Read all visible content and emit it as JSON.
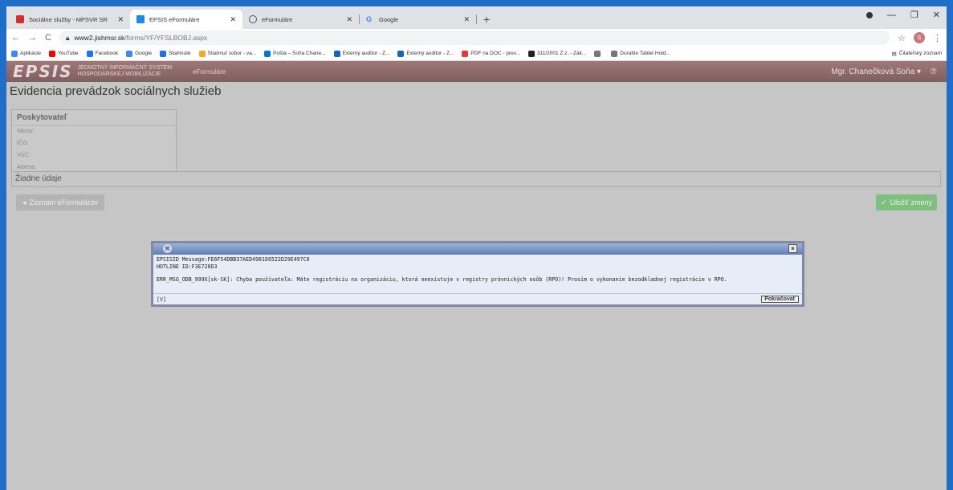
{
  "browser": {
    "tabs": [
      {
        "title": "Sociálne služby - MPSVR SR",
        "active": false,
        "favicon_color": "#d32f2f"
      },
      {
        "title": "EPSIS eFormuláre",
        "active": true,
        "favicon_color": "#1e88e5"
      },
      {
        "title": "eFormuláre",
        "active": false,
        "favicon_color": "#555555"
      },
      {
        "title": "Google",
        "active": false,
        "favicon_color": "#4285f4"
      }
    ],
    "url_host": "www2.jishmsr.sk",
    "url_path": "/forms/YF/YFSLBOBJ.aspx",
    "bookmarks": [
      {
        "label": "Aplikácie",
        "color": "#4285f4"
      },
      {
        "label": "YouTube",
        "color": "#ff0000"
      },
      {
        "label": "Facebook",
        "color": "#1877f2"
      },
      {
        "label": "Google",
        "color": "#4285f4"
      },
      {
        "label": "Stiahnuté",
        "color": "#1a73e8"
      },
      {
        "label": "Stiahnuť súbor - va...",
        "color": "#f9a825"
      },
      {
        "label": "Pošta – Soňa Chane...",
        "color": "#0078d4"
      },
      {
        "label": "Externý auditor - Z...",
        "color": "#1565c0"
      },
      {
        "label": "Externý auditor - Z...",
        "color": "#1565c0"
      },
      {
        "label": "PDF na DOC - prev...",
        "color": "#e53935"
      },
      {
        "label": "311/2001 Z.z. - Zák...",
        "color": "#222222"
      },
      {
        "label": "",
        "color": "#777777"
      },
      {
        "label": "Durable Tablet Hold...",
        "color": "#777777"
      }
    ],
    "reading_list": "Čitateľský zoznam",
    "avatar_letter": "S"
  },
  "app": {
    "logo": "EPSIS",
    "logo_sub_1": "Jednotný informačný systém",
    "logo_sub_2": "hospodárskej mobilizácie",
    "module": "eFormuláre",
    "user": "Mgr. Chanečková Soňa",
    "user_caret": "▾",
    "help": "⑦",
    "page_title": "Evidencia prevádzok sociálnych služieb",
    "provider": {
      "heading": "Poskytovateľ",
      "fields": [
        "Názov:",
        "IČO:",
        "VÚC:",
        "Adresa:"
      ]
    },
    "no_data": "Žiadne údaje",
    "list_button": "Zoznam eFormulárov",
    "save_button": "Uložiť zmeny"
  },
  "dialog": {
    "line1": "EPSISID Message:FE6F54DBB37AED4981E6522D29E497C0",
    "line2": "HOTLINE ID:F3E726D3",
    "line3": "ERR_MSG_ODB_999X[sk-SK]: Chyba používateľa: Máte registráciu na organizáciu, ktorá neexistuje v registry právnických osôb (RPO)! Prosím o vykonanie bezodkladnej registrácie v RPO.",
    "footer_left": "[V]",
    "continue_button": "Pokračovať",
    "close": "×"
  }
}
